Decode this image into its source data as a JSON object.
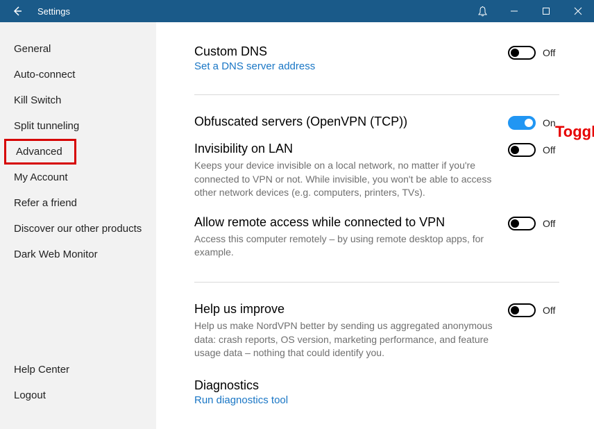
{
  "titlebar": {
    "title": "Settings"
  },
  "sidebar": {
    "items": [
      {
        "label": "General"
      },
      {
        "label": "Auto-connect"
      },
      {
        "label": "Kill Switch"
      },
      {
        "label": "Split tunneling"
      },
      {
        "label": "Advanced"
      },
      {
        "label": "My Account"
      },
      {
        "label": "Refer a friend"
      },
      {
        "label": "Discover our other products"
      },
      {
        "label": "Dark Web Monitor"
      }
    ],
    "bottom": [
      {
        "label": "Help Center"
      },
      {
        "label": "Logout"
      }
    ]
  },
  "main": {
    "custom_dns": {
      "title": "Custom DNS",
      "link": "Set a DNS server address",
      "off": "Off"
    },
    "obfuscated": {
      "title": "Obfuscated servers (OpenVPN (TCP))",
      "on": "On"
    },
    "invisibility": {
      "title": "Invisibility on LAN",
      "desc": "Keeps your device invisible on a local network, no matter if you're connected to VPN or not. While invisible, you won't be able to access other network devices (e.g. computers, printers, TVs).",
      "off": "Off"
    },
    "remote": {
      "title": "Allow remote access while connected to VPN",
      "desc": "Access this computer remotely – by using remote desktop apps, for example.",
      "off": "Off"
    },
    "improve": {
      "title": "Help us improve",
      "desc": "Help us make NordVPN better by sending us aggregated anonymous data: crash reports, OS version, marketing performance, and feature usage data – nothing that could identify you.",
      "off": "Off"
    },
    "diagnostics": {
      "title": "Diagnostics",
      "link": "Run diagnostics tool"
    }
  },
  "annotation": {
    "text": "Toggle on"
  }
}
